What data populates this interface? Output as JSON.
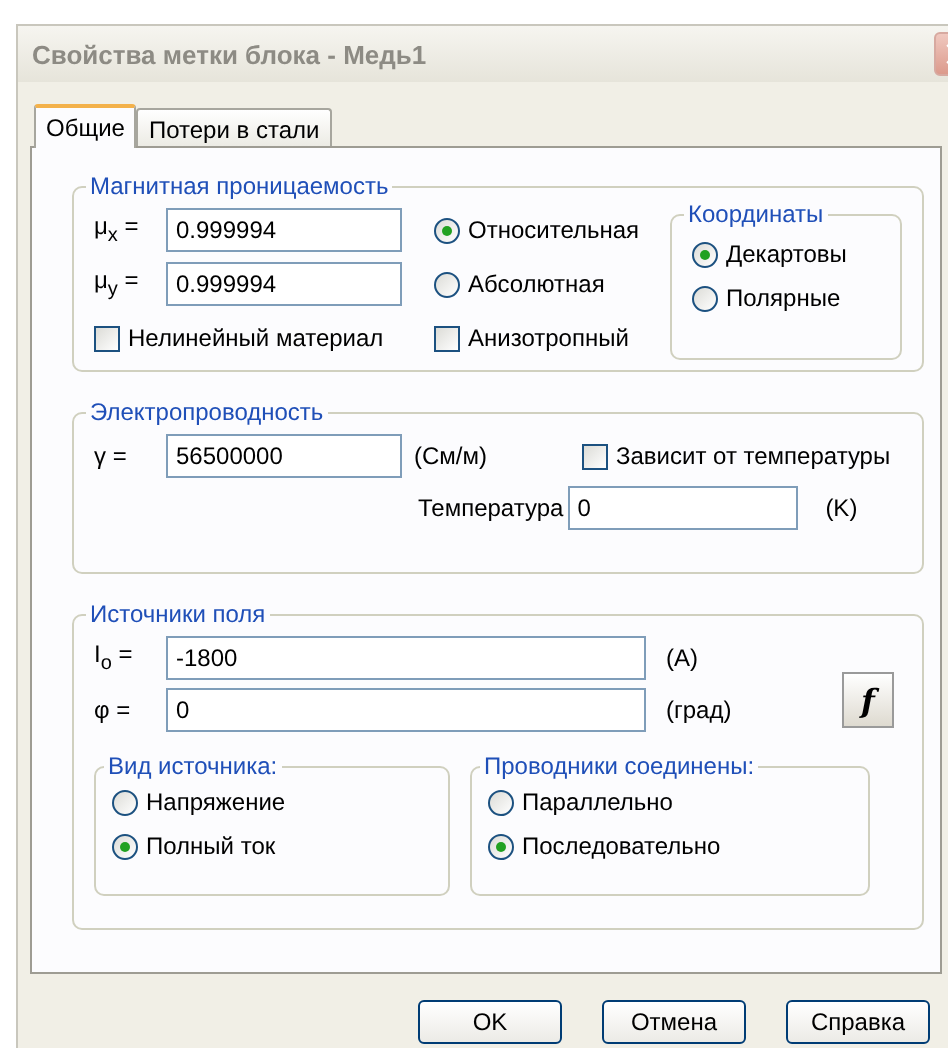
{
  "window": {
    "title": "Свойства метки блока - Медь1"
  },
  "tabs": [
    {
      "label": "Общие",
      "selected": true
    },
    {
      "label": "Потери в стали",
      "selected": false
    }
  ],
  "permeability": {
    "title": "Магнитная проницаемость",
    "fields": [
      {
        "label": "μ$_{x}$ =",
        "value": "0.999994"
      },
      {
        "label": "μ$_{y}$ =",
        "value": "0.999994"
      }
    ],
    "mode": [
      {
        "label": "Относительная",
        "selected": true
      },
      {
        "label": "Абсолютная",
        "selected": false
      }
    ],
    "nonlinear": {
      "label": "Нелинейный материал",
      "checked": false
    },
    "anisotropic": {
      "label": "Анизотропный",
      "checked": false
    },
    "coordinates": {
      "title": "Координаты",
      "options": [
        {
          "label": "Декартовы",
          "selected": true
        },
        {
          "label": "Полярные",
          "selected": false
        }
      ]
    }
  },
  "conductivity": {
    "title": "Электропроводность",
    "label": "γ =",
    "value": "56500000",
    "unit": "(См/м)",
    "temperature_dependent": {
      "label": "Зависит от температуры",
      "checked": false
    },
    "temperature": {
      "label": "Температура",
      "value": "0",
      "unit": "(K)"
    }
  },
  "sources": {
    "title": "Источники поля",
    "fields": [
      {
        "label": "I$_{o}$ =",
        "value": "-1800",
        "unit": "(A)"
      },
      {
        "label": "φ =",
        "value": "0",
        "unit": "(град)"
      }
    ],
    "function_button": "f",
    "source_type": {
      "title": "Вид источника:",
      "options": [
        {
          "label": "Напряжение",
          "selected": false
        },
        {
          "label": "Полный ток",
          "selected": true
        }
      ]
    },
    "connection": {
      "title": "Проводники соединены:",
      "options": [
        {
          "label": "Параллельно",
          "selected": false
        },
        {
          "label": "Последовательно",
          "selected": true
        }
      ]
    }
  },
  "buttons": [
    "OK",
    "Отмена",
    "Справка"
  ]
}
